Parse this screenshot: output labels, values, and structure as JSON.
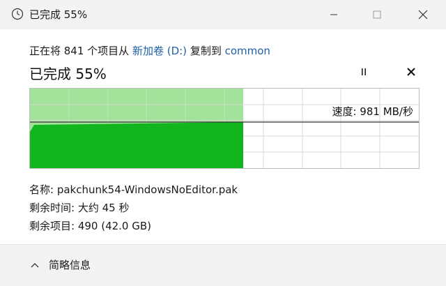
{
  "window": {
    "title": "已完成 55%",
    "icon": "clock-icon"
  },
  "copy": {
    "prefix": "正在将 841 个项目从",
    "source": "新加卷 (D:)",
    "middle": "复制到",
    "destination": "common"
  },
  "progress": {
    "title": "已完成 55%",
    "percent": 55
  },
  "speed": {
    "label": "速度: 981 MB/秒"
  },
  "details": {
    "name": "名称: pakchunk54-WindowsNoEditor.pak",
    "time_left": "剩余时间: 大约 45 秒",
    "items_left": "剩余项目: 490 (42.0 GB)"
  },
  "footer": {
    "label": "简略信息"
  },
  "colors": {
    "fill_light": "#a3e29a",
    "fill_dark": "#11b51e",
    "grid": "#d9d9d9",
    "link": "#1e5fa8"
  }
}
